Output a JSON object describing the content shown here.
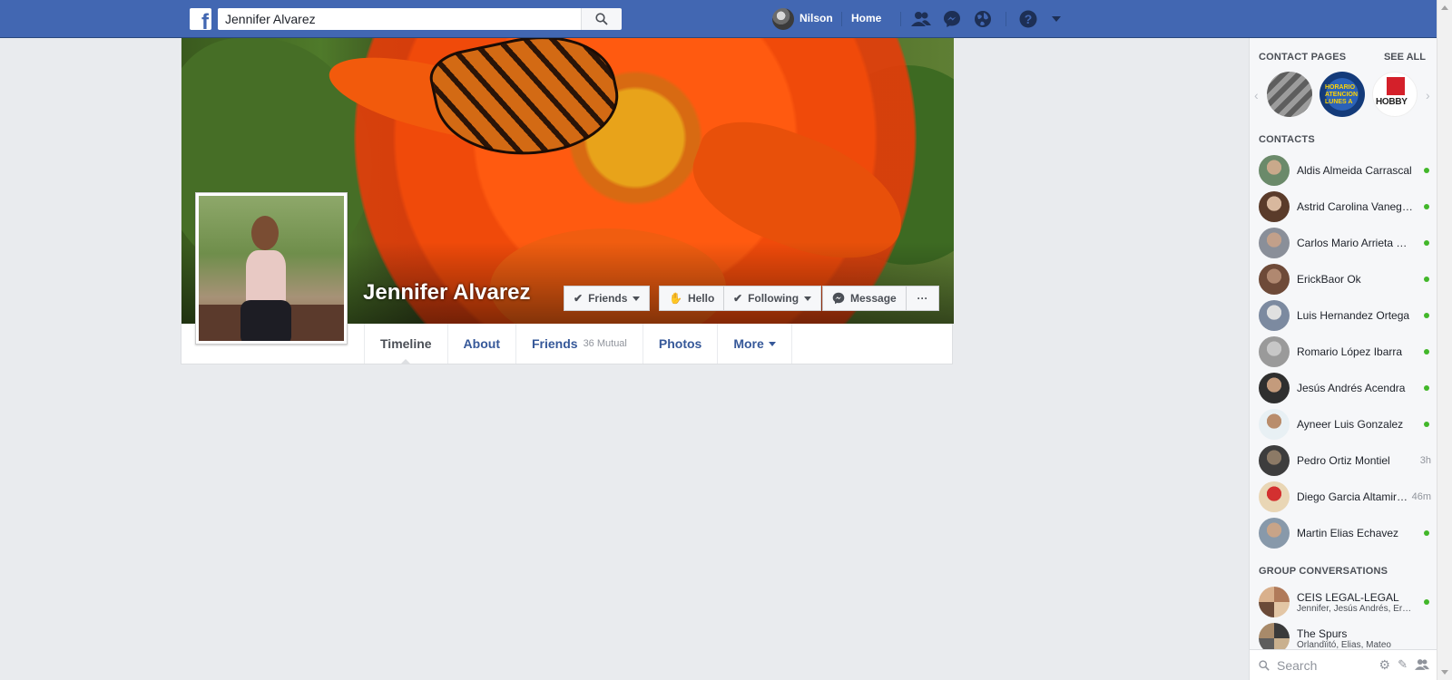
{
  "topbar": {
    "search_value": "Jennifer Alvarez",
    "user_name": "Nilson",
    "home_label": "Home",
    "brand_color": "#4267b2"
  },
  "profile": {
    "name": "Jennifer Alvarez",
    "buttons": {
      "friends": "Friends",
      "hello": "Hello",
      "following": "Following",
      "message": "Message",
      "more": "···"
    },
    "tabs": {
      "timeline": "Timeline",
      "about": "About",
      "friends": "Friends",
      "friends_mutual": "36 Mutual",
      "photos": "Photos",
      "more": "More"
    }
  },
  "sidebar": {
    "contact_pages_title": "CONTACT PAGES",
    "see_all": "SEE ALL",
    "pages": [
      {
        "label": ""
      },
      {
        "label": "HORARIO ATENCION LUNES A VIERNES SABADOS"
      },
      {
        "label": "HOBBY"
      }
    ],
    "contacts_title": "CONTACTS",
    "contacts": [
      {
        "name": "Aldis Almeida Carrascal",
        "status": "online"
      },
      {
        "name": "Astrid Carolina Vanegas",
        "status": "online"
      },
      {
        "name": "Carlos Mario Arrieta Pérez",
        "status": "online"
      },
      {
        "name": "ErickBaor Ok",
        "status": "online"
      },
      {
        "name": "Luis Hernandez Ortega",
        "status": "online"
      },
      {
        "name": "Romario López Ibarra",
        "status": "online"
      },
      {
        "name": "Jesús Andrés Acendra",
        "status": "online"
      },
      {
        "name": "Ayneer Luis Gonzalez",
        "status": "online"
      },
      {
        "name": "Pedro Ortiz Montiel",
        "status": "3h"
      },
      {
        "name": "Diego Garcia Altamiranda",
        "status": "46m"
      },
      {
        "name": "Martin Elias Echavez",
        "status": "online"
      }
    ],
    "group_title": "GROUP CONVERSATIONS",
    "groups": [
      {
        "name": "CEIS LEGAL-LEGAL",
        "members": "Jennifer, Jesús Andrés, Erick"
      },
      {
        "name": "The Spurs",
        "members": "Órlandïitó, Elias, Mateo"
      }
    ],
    "search_placeholder": "Search"
  }
}
